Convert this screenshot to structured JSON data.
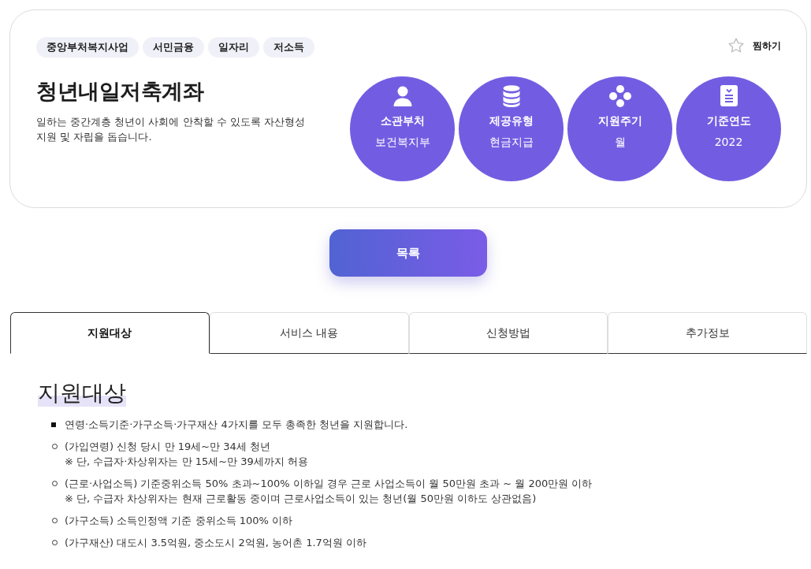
{
  "card": {
    "tags": [
      "중앙부처복지사업",
      "서민금융",
      "일자리",
      "저소득"
    ],
    "title": "청년내일저축계좌",
    "description": [
      "일하는 중간계층 청년이 사회에 안착할 수 있도록 자산형성",
      "지원 및 자립을 돕습니다."
    ],
    "favorite": {
      "label": "찜하기",
      "on": false
    },
    "facts": [
      {
        "label": "소관부처",
        "value": "보건복지부"
      },
      {
        "label": "제공유형",
        "value": "현금지급"
      },
      {
        "label": "지원주기",
        "value": "월"
      },
      {
        "label": "기준연도",
        "value": "2022"
      }
    ]
  },
  "list_button": "목록",
  "tabs": [
    {
      "label": "지원대상",
      "selected": true
    },
    {
      "label": "서비스 내용",
      "selected": false
    },
    {
      "label": "신청방법",
      "selected": false
    },
    {
      "label": "추가정보",
      "selected": false
    }
  ],
  "section": {
    "heading": "지원대상",
    "items": [
      {
        "kind": "summary",
        "text": "연령·소득기준·가구소득·가구재산 4가지를 모두 총족한 청년을 지원합니다."
      },
      {
        "kind": "criterion",
        "text": "(가입연령) 신청 당시 만 19세~만 34세 청년",
        "note": "※ 단, 수급자·차상위자는 만 15세~만 39세까지 허용"
      },
      {
        "kind": "criterion",
        "text": "(근로·사업소득) 기준중위소득 50% 초과~100% 이하일 경우 근로 사업소득이 월 50만원 초과 ~ 월 200만원 이하",
        "note": "※ 단, 수급자 차상위자는 현재 근로활동 중이며 근로사업소득이 있는 청년(월 50만원 이하도 상관없음)"
      },
      {
        "kind": "criterion",
        "text": "(가구소득) 소득인정액 기준 중위소득 100% 이하"
      },
      {
        "kind": "criterion",
        "text": "(가구재산) 대도시 3.5억원, 중소도시 2억원, 농어촌 1.7억원 이하"
      }
    ]
  }
}
